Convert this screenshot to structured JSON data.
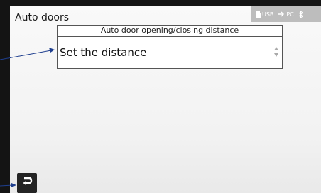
{
  "window": {
    "title": "Auto doors"
  },
  "status_bar": {
    "usb_label": "USB",
    "pc_label": "PC",
    "usb_icon": "usb-icon",
    "pc_icon": "pc-link-icon",
    "bluetooth_icon": "bluetooth-icon"
  },
  "setting": {
    "header": "Auto door opening/closing distance",
    "value": "Set the distance",
    "stepper_icon": "up-down-stepper-icon"
  },
  "footer": {
    "back_icon": "back-return-icon"
  },
  "colors": {
    "bezel": "#141414",
    "screen": "#f4f4f4",
    "status_bar": "#bdbdbd",
    "annotation_arrow": "#1f3f8f"
  }
}
